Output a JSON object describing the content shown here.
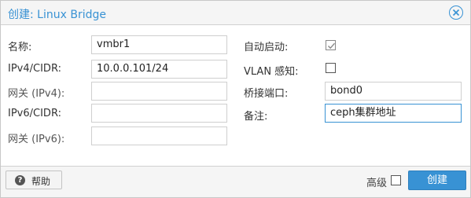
{
  "dialog": {
    "title": "创建: Linux Bridge",
    "close_icon": "close-icon"
  },
  "form": {
    "left": {
      "name": {
        "label": "名称:",
        "value": "vmbr1"
      },
      "ipv4": {
        "label": "IPv4/CIDR:",
        "value": "10.0.0.101/24"
      },
      "gateway4": {
        "label": "网关 (IPv4):",
        "value": ""
      },
      "ipv6": {
        "label": "IPv6/CIDR:",
        "value": ""
      },
      "gateway6": {
        "label": "网关 (IPv6):",
        "value": ""
      }
    },
    "right": {
      "autostart": {
        "label": "自动启动:",
        "checked": true
      },
      "vlan_aware": {
        "label": "VLAN 感知:",
        "checked": false
      },
      "bridge_ports": {
        "label": "桥接端口:",
        "value": "bond0"
      },
      "comment": {
        "label": "备注:",
        "value": "ceph集群地址"
      }
    }
  },
  "footer": {
    "help_label": "帮助",
    "help_icon": "question-circle-icon",
    "advanced_label": "高级",
    "advanced_checked": false,
    "create_label": "创建"
  },
  "colors": {
    "accent": "#3892d4",
    "header_bg": "#f5f5f5",
    "border": "#cfcfcf"
  }
}
